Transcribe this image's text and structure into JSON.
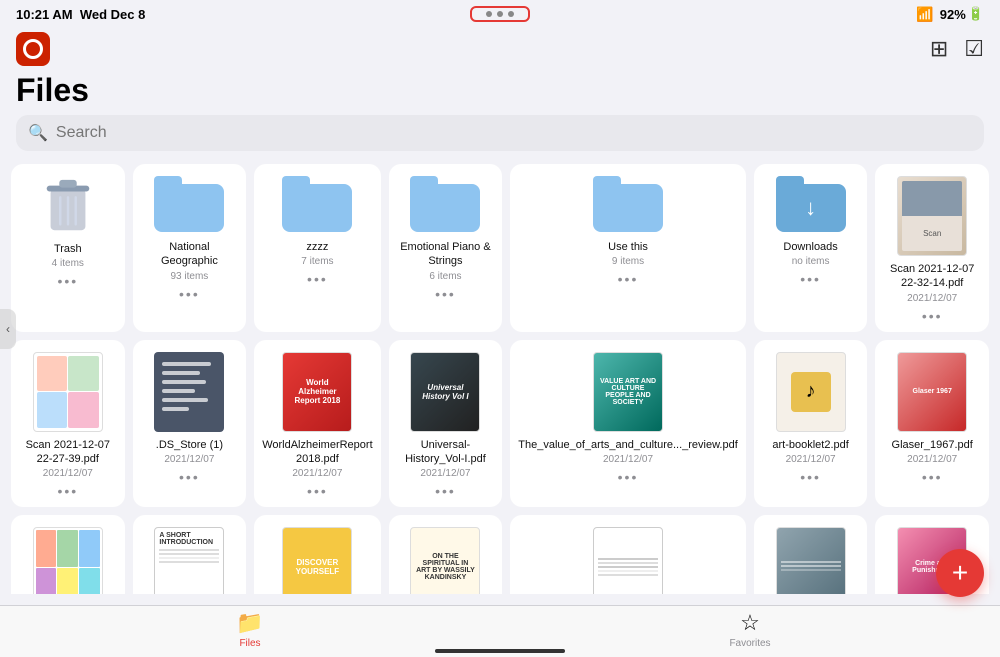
{
  "status": {
    "time": "10:21 AM",
    "day": "Wed Dec 8",
    "battery": "92%",
    "wifi": true
  },
  "header": {
    "title": "Files",
    "dots_label": "•••"
  },
  "search": {
    "placeholder": "Search"
  },
  "grid_row1": [
    {
      "id": "trash",
      "type": "trash",
      "name": "Trash",
      "meta": "4 items"
    },
    {
      "id": "national-geographic",
      "type": "folder",
      "name": "National Geographic",
      "meta": "93 items"
    },
    {
      "id": "zzzz",
      "type": "folder",
      "name": "zzzz",
      "meta": "7 items"
    },
    {
      "id": "emotional-piano",
      "type": "folder",
      "name": "Emotional Piano & Strings",
      "meta": "6 items"
    },
    {
      "id": "use-this",
      "type": "folder",
      "name": "Use this",
      "meta": "9 items"
    },
    {
      "id": "downloads",
      "type": "folder-download",
      "name": "Downloads",
      "meta": "no items"
    },
    {
      "id": "scan1",
      "type": "photo",
      "name": "Scan 2021-12-07 22-32-14.pdf",
      "meta": "2021/12/07"
    }
  ],
  "grid_row2": [
    {
      "id": "scan2",
      "type": "file-screenshot",
      "name": "Scan 2021-12-07 22-27-39.pdf",
      "meta": "2021/12/07"
    },
    {
      "id": "ds-store",
      "type": "file-doc",
      "name": ".DS_Store (1)",
      "meta": "2021/12/07"
    },
    {
      "id": "world-alz",
      "type": "file-red",
      "name": "WorldAlzheimerReport 2018.pdf",
      "meta": "2021/12/07"
    },
    {
      "id": "universal-hist",
      "type": "file-dark",
      "name": "Universal-History_Vol-I.pdf",
      "meta": "2021/12/07"
    },
    {
      "id": "value-arts",
      "type": "file-teal",
      "name": "The_value_of_arts_and_culture..._review.pdf",
      "meta": "2021/12/07"
    },
    {
      "id": "art-booklet",
      "type": "file-yellow",
      "name": "art-booklet2.pdf",
      "meta": "2021/12/07"
    },
    {
      "id": "glaser",
      "type": "file-pink",
      "name": "Glaser_1967.pdf",
      "meta": "2021/12/07"
    }
  ],
  "grid_row3": [
    {
      "id": "file-r3-1",
      "type": "file-collage",
      "name": "",
      "meta": ""
    },
    {
      "id": "file-r3-2",
      "type": "file-white",
      "name": "",
      "meta": ""
    },
    {
      "id": "file-r3-3",
      "type": "file-yellow2",
      "name": "",
      "meta": ""
    },
    {
      "id": "file-r3-4",
      "type": "file-colorful",
      "name": "",
      "meta": ""
    },
    {
      "id": "file-r3-5",
      "type": "file-plain",
      "name": "",
      "meta": ""
    },
    {
      "id": "file-r3-6",
      "type": "file-lines",
      "name": "",
      "meta": ""
    },
    {
      "id": "file-r3-7",
      "type": "file-map",
      "name": "",
      "meta": ""
    }
  ],
  "tabs": [
    {
      "id": "files",
      "label": "Files",
      "active": true
    },
    {
      "id": "favorites",
      "label": "Favorites",
      "active": false
    }
  ],
  "fab": {
    "label": "+"
  }
}
